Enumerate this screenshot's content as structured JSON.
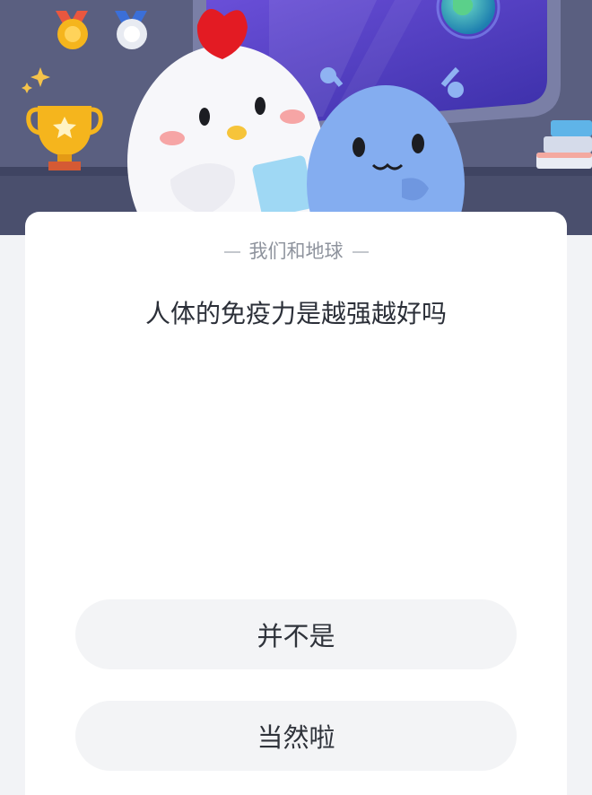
{
  "quiz": {
    "category": "我们和地球",
    "question": "人体的免疫力是越强越好吗",
    "options": [
      {
        "label": "并不是"
      },
      {
        "label": "当然啦"
      }
    ]
  },
  "banner": {
    "background_color": "#545a78",
    "characters": [
      "chicken-mascot",
      "blue-alien-mascot"
    ],
    "decorations": [
      "gold-medal-icon",
      "silver-medal-icon",
      "trophy-icon",
      "globe-icon",
      "books-icon",
      "sparkle-icon"
    ]
  },
  "colors": {
    "card": "#ffffff",
    "option_bg": "#f3f4f6",
    "text_primary": "#2b2f38",
    "text_secondary": "#8e939d"
  }
}
